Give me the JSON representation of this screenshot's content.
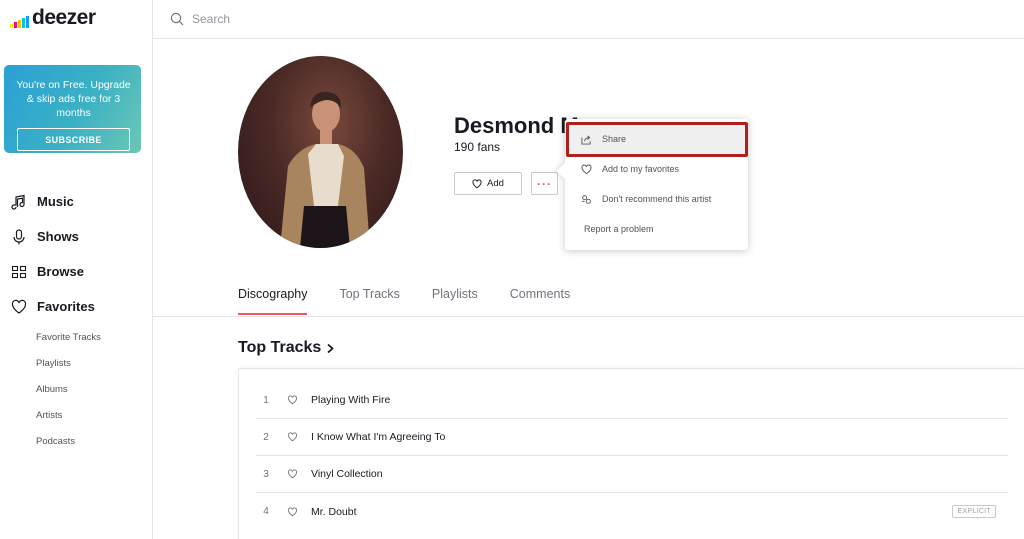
{
  "brand": {
    "name": "deezer",
    "bar_colors": [
      "#ffed00",
      "#ff0092",
      "#ffc400",
      "#00c7f2",
      "#1a9df4",
      "#22b24c"
    ]
  },
  "promo": {
    "text": "You're on Free. Upgrade & skip ads free for 3 months",
    "button": "SUBSCRIBE"
  },
  "nav": {
    "items": [
      {
        "label": "Music",
        "icon": "music-note-icon"
      },
      {
        "label": "Shows",
        "icon": "microphone-icon"
      },
      {
        "label": "Browse",
        "icon": "grid-icon"
      },
      {
        "label": "Favorites",
        "icon": "heart-icon"
      }
    ],
    "sub_items": [
      "Favorite Tracks",
      "Playlists",
      "Albums",
      "Artists",
      "Podcasts"
    ]
  },
  "search": {
    "placeholder": "Search"
  },
  "artist": {
    "name": "Desmond M",
    "fans": "190 fans",
    "add_label": "Add",
    "more_label": "···"
  },
  "menu": {
    "items": [
      {
        "label": "Share",
        "icon": "share-icon"
      },
      {
        "label": "Add to my favorites",
        "icon": "heart-icon"
      },
      {
        "label": "Don't recommend this artist",
        "icon": "not-recommend-icon"
      },
      {
        "label": "Report a problem",
        "icon": ""
      }
    ]
  },
  "tabs": [
    "Discography",
    "Top Tracks",
    "Playlists",
    "Comments"
  ],
  "active_tab": "Discography",
  "top_tracks": {
    "title": "Top Tracks",
    "tracks": [
      {
        "num": "1",
        "title": "Playing With Fire",
        "badge": ""
      },
      {
        "num": "2",
        "title": "I Know What I'm Agreeing To",
        "badge": ""
      },
      {
        "num": "3",
        "title": "Vinyl Collection",
        "badge": ""
      },
      {
        "num": "4",
        "title": "Mr. Doubt",
        "badge": "EXPLICIT"
      }
    ]
  },
  "colors": {
    "accent": "#ef5466",
    "highlight": "#b11e1e"
  }
}
